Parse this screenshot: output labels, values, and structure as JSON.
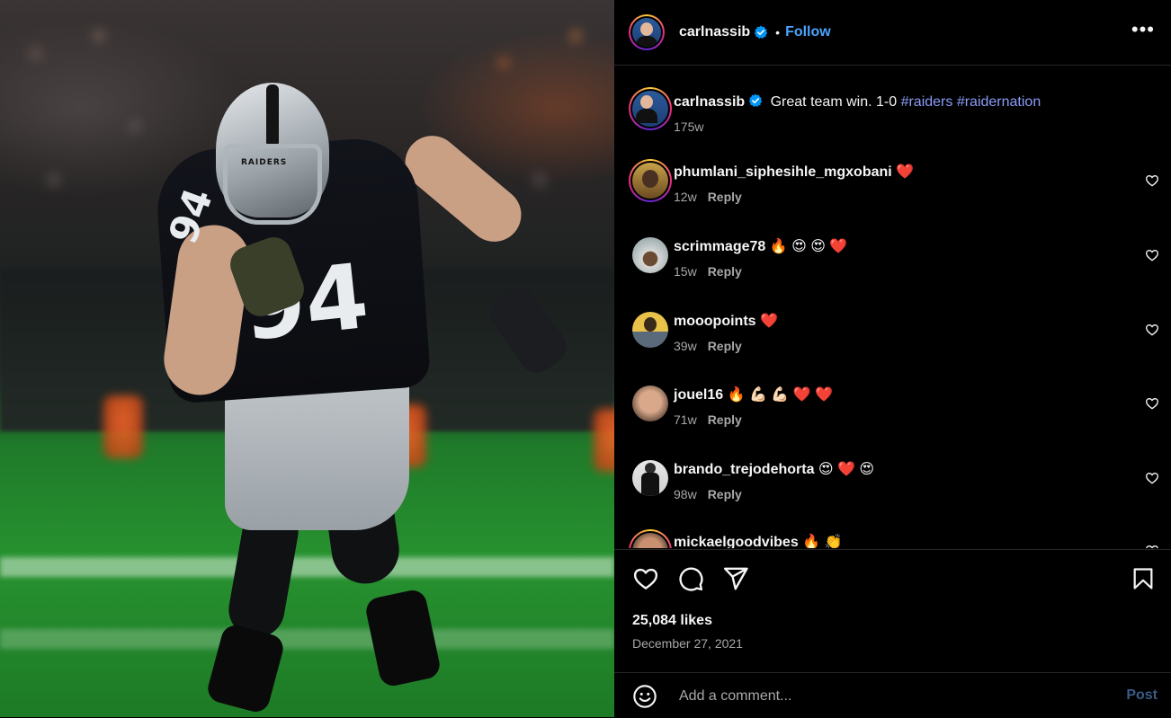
{
  "post": {
    "author": "carlnassib",
    "follow_label": "Follow",
    "dot": "•",
    "more_label": "•••",
    "caption_text": "Great team win. 1-0 ",
    "caption_tags": [
      "#raiders",
      "#raidernation"
    ],
    "caption_age": "175w",
    "likes": "25,084 likes",
    "date": "December 27, 2021"
  },
  "photo": {
    "jersey_number": "94",
    "helmet_text": "RAIDERS"
  },
  "comments": [
    {
      "username": "phumlani_siphesihle_mgxobani",
      "text": "❤️",
      "age": "12w",
      "reply": "Reply"
    },
    {
      "username": "scrimmage78",
      "text": "🔥 😍 😍 ❤️",
      "age": "15w",
      "reply": "Reply"
    },
    {
      "username": "mooopoints",
      "text": "❤️",
      "age": "39w",
      "reply": "Reply"
    },
    {
      "username": "jouel16",
      "text": "🔥 💪🏻 💪🏻 ❤️ ❤️",
      "age": "71w",
      "reply": "Reply"
    },
    {
      "username": "brando_trejodehorta",
      "text": "😍 ❤️ 😍",
      "age": "98w",
      "reply": "Reply"
    },
    {
      "username": "mickaelgoodvibes",
      "text": "🔥 👏",
      "age": "",
      "reply": ""
    }
  ],
  "add_comment": {
    "placeholder": "Add a comment...",
    "post_label": "Post"
  },
  "icons": {
    "verified": "verified-badge-icon",
    "like": "heart-icon",
    "comment": "comment-icon",
    "share": "share-icon",
    "save": "bookmark-icon",
    "emoji": "emoji-icon",
    "more": "more-options-icon"
  },
  "colors": {
    "accent": "#4aa3ff",
    "hashtag": "#8a9cf7",
    "verified": "#0095f6",
    "post_disabled": "#3a5b85",
    "heart_red": "#ff3040"
  }
}
